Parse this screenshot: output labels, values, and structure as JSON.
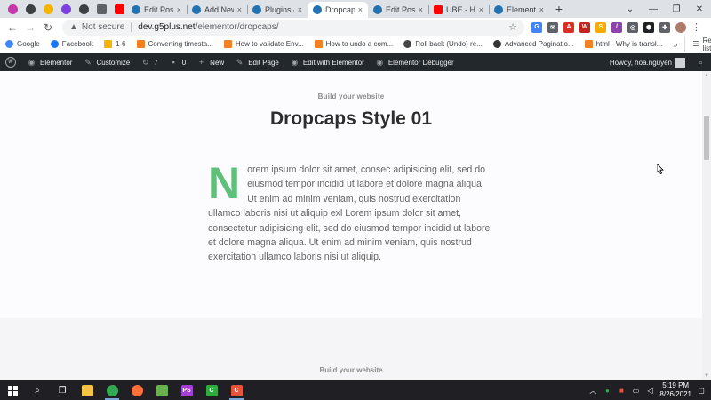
{
  "tabs": [
    {
      "title": "Edit Post ‹",
      "color": "#2271b1",
      "active": false
    },
    {
      "title": "Add New",
      "color": "#2271b1",
      "active": false
    },
    {
      "title": "Plugins ‹",
      "color": "#2271b1",
      "active": false
    },
    {
      "title": "Dropcaps",
      "color": "#2271b1",
      "active": true
    },
    {
      "title": "Edit Post ‹",
      "color": "#2271b1",
      "active": false
    },
    {
      "title": "UBE - How",
      "color": "#ff0000",
      "active": false
    },
    {
      "title": "Elementor",
      "color": "#2271b1",
      "active": false
    }
  ],
  "tab_close_glyph": "×",
  "new_tab_glyph": "+",
  "address": {
    "security": "Not secure",
    "host": "dev.g5plus.net",
    "path": "/elementor/dropcaps/"
  },
  "bookmarks": [
    {
      "label": "Google",
      "color": "#4285f4"
    },
    {
      "label": "Facebook",
      "color": "#1877f2"
    },
    {
      "label": "1-6",
      "color": "#f4b400"
    },
    {
      "label": "Converting timesta...",
      "color": "#f48024"
    },
    {
      "label": "How to validate Env...",
      "color": "#f48024"
    },
    {
      "label": "How to undo a com...",
      "color": "#f48024"
    },
    {
      "label": "Roll back (Undo) re...",
      "color": "#444444"
    },
    {
      "label": "Advanced Paginatio...",
      "color": "#333333"
    },
    {
      "label": "html - Why is transl...",
      "color": "#f48024"
    }
  ],
  "bookmarks_more": "»",
  "reading_list": "Reading list",
  "wp_admin_bar": {
    "logo": "W",
    "elementor": "Elementor",
    "customize": "Customize",
    "updates": "7",
    "comments": "0",
    "new": "New",
    "edit_page": "Edit Page",
    "edit_with_elementor": "Edit with Elementor",
    "debugger": "Elementor Debugger",
    "howdy": "Howdy, hoa.nguyen"
  },
  "content": {
    "subtitle": "Build your website",
    "title": "Dropcaps Style 01",
    "dropcap_letter": "N",
    "dropcap_color": "#5fc07a",
    "paragraph": "orem ipsum dolor sit amet, consec adipisicing elit, sed do eiusmod tempor incidid ut labore et dolore magna aliqua. Ut enim ad minim veniam, quis nostrud exercitation ullamco laboris nisi ut aliquip exl Lorem ipsum dolor sit amet, consectetur adipisicing elit, sed do eiusmod tempor incidid ut labore et dolore magna aliqua. Ut enim ad minim veniam, quis nostrud exercitation ullamco laboris nisi ut aliquip.",
    "subtitle2": "Build your website"
  },
  "taskbar": {
    "time": "5:19 PM",
    "date": "8/26/2021"
  }
}
